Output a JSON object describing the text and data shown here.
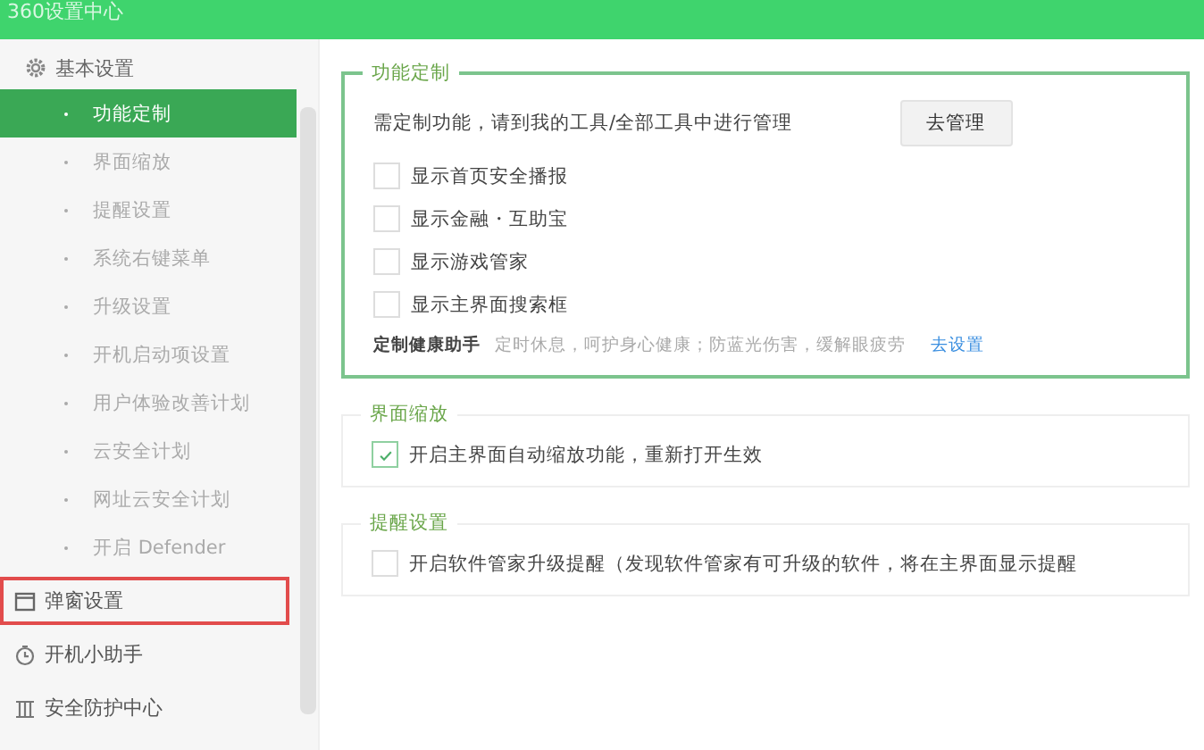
{
  "window": {
    "title": "360设置中心"
  },
  "sidebar": {
    "section": {
      "label": "基本设置"
    },
    "items": [
      {
        "label": "功能定制",
        "selected": true
      },
      {
        "label": "界面缩放",
        "selected": false
      },
      {
        "label": "提醒设置",
        "selected": false
      },
      {
        "label": "系统右键菜单",
        "selected": false
      },
      {
        "label": "升级设置",
        "selected": false
      },
      {
        "label": "开机启动项设置",
        "selected": false
      },
      {
        "label": "用户体验改善计划",
        "selected": false
      },
      {
        "label": "云安全计划",
        "selected": false
      },
      {
        "label": "网址云安全计划",
        "selected": false
      },
      {
        "label": "开启 Defender",
        "selected": false
      }
    ],
    "groups": [
      {
        "label": "弹窗设置",
        "highlighted": true
      },
      {
        "label": "开机小助手",
        "highlighted": false
      },
      {
        "label": "安全防护中心",
        "highlighted": false
      }
    ]
  },
  "panels": [
    {
      "title": "功能定制",
      "active": true,
      "note": "需定制功能，请到我的工具/全部工具中进行管理",
      "button": "去管理",
      "options": [
        {
          "label": "显示首页安全播报",
          "checked": false
        },
        {
          "label": "显示金融・互助宝",
          "checked": false
        },
        {
          "label": "显示游戏管家",
          "checked": false
        },
        {
          "label": "显示主界面搜索框",
          "checked": false
        }
      ],
      "health": {
        "label": "定制健康助手",
        "hint": "定时休息，呵护身心健康；防蓝光伤害，缓解眼疲劳",
        "link": "去设置"
      }
    },
    {
      "title": "界面缩放",
      "active": false,
      "options": [
        {
          "label": "开启主界面自动缩放功能，重新打开生效",
          "checked": true
        }
      ]
    },
    {
      "title": "提醒设置",
      "active": false,
      "options": [
        {
          "label": "开启软件管家升级提醒（发现软件管家有可升级的软件，将在主界面显示提醒",
          "checked": false
        }
      ]
    }
  ]
}
